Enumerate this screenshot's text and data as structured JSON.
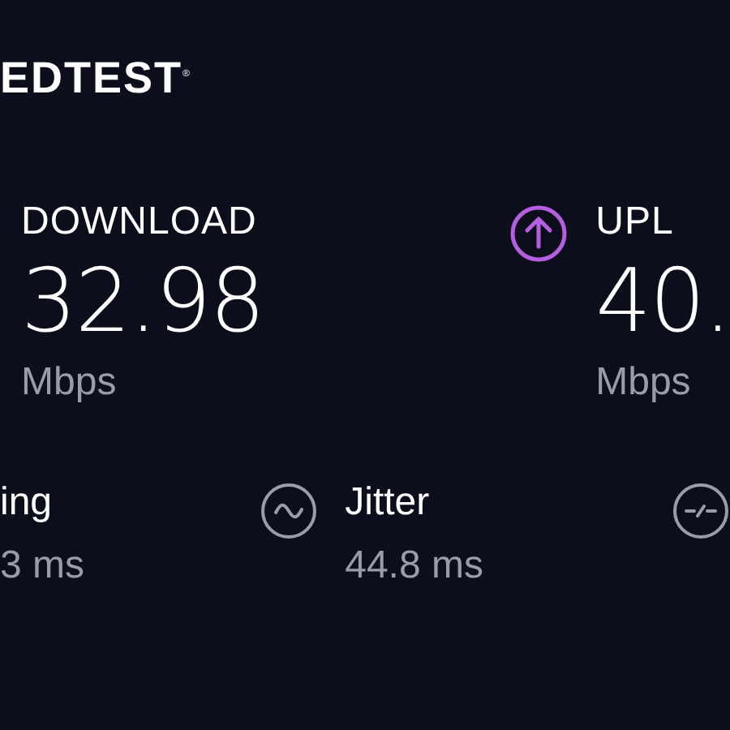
{
  "logo": "EDTEST$^{®}$",
  "results": [
    {
      "kind": "download",
      "label": "DOWNLOAD",
      "value": "32.98",
      "unit": "Mbps"
    },
    {
      "kind": "upload",
      "label": "UPL",
      "value": "40.",
      "unit": "Mbps"
    }
  ],
  "metrics": [
    {
      "kind": "ping",
      "label": "ing",
      "value": "3 ms"
    },
    {
      "kind": "jitter",
      "label": "Jitter",
      "value": "44.8 ms"
    },
    {
      "kind": "loss"
    }
  ]
}
